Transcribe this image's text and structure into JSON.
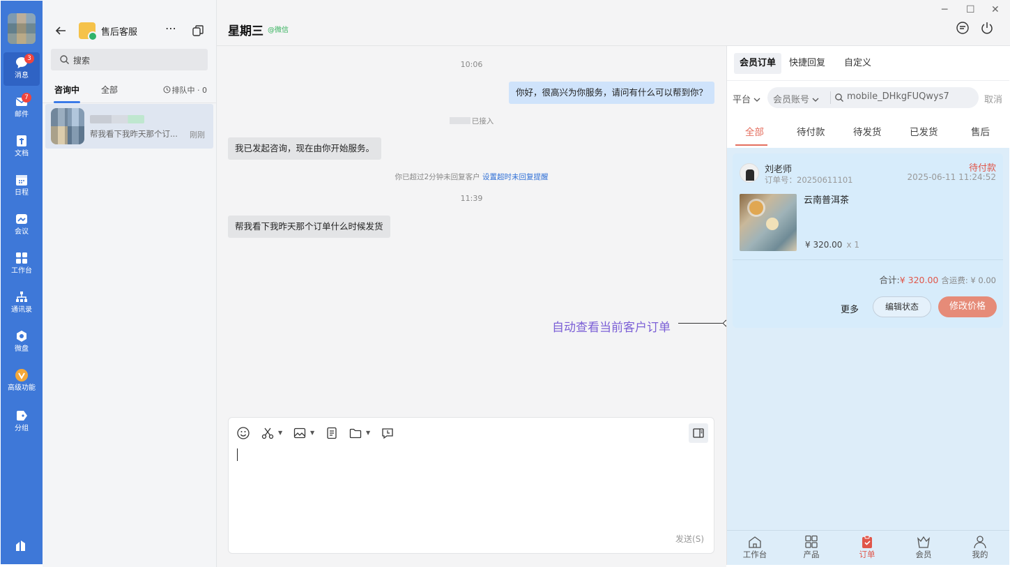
{
  "rail": {
    "items": [
      {
        "label": "消息",
        "badge": "3",
        "icon": "chat-bubble-icon"
      },
      {
        "label": "邮件",
        "badge": "7",
        "icon": "mail-icon"
      },
      {
        "label": "文档",
        "icon": "document-icon"
      },
      {
        "label": "日程",
        "icon": "calendar-icon"
      },
      {
        "label": "会议",
        "icon": "meeting-icon"
      },
      {
        "label": "工作台",
        "icon": "grid-icon"
      },
      {
        "label": "通讯录",
        "icon": "org-chart-icon"
      },
      {
        "label": "微盘",
        "icon": "cloud-drive-icon"
      },
      {
        "label": "高级功能",
        "icon": "premium-icon"
      },
      {
        "label": "分组",
        "icon": "tag-icon"
      }
    ]
  },
  "list": {
    "shop_name": "售后客服",
    "search_placeholder": "搜索",
    "tab_active": "咨询中",
    "tab_all": "全部",
    "queue": "排队中 · 0",
    "conversation": {
      "preview": "帮我看下我昨天那个订...",
      "time": "刚刚"
    }
  },
  "chat": {
    "title": "星期三",
    "channel": "@微信",
    "messages": {
      "time1": "10:06",
      "greeting": "你好，很高兴为你服务，请问有什么可以帮到你？",
      "joined": "已接入",
      "started": "我已发起咨询，现在由你开始服务。",
      "timeout_note": "你已超过2分钟未回复客户",
      "timeout_link": "设置超时未回复提醒",
      "time2": "11:39",
      "customer_msg": "帮我看下我昨天那个订单什么时候发货"
    },
    "annotation": "自动查看当前客户订单",
    "send_label": "发送(S)"
  },
  "window_controls": {
    "minimize": "─",
    "maximize": "☐",
    "close": "✕"
  },
  "right": {
    "tabs": [
      "会员订单",
      "快捷回复",
      "自定义"
    ],
    "platform": "平台",
    "account_label": "会员账号",
    "account_value": "mobile_DHkgFUQwys7",
    "cancel": "取消",
    "status_tabs": [
      "全部",
      "待付款",
      "待发货",
      "已发货",
      "售后"
    ],
    "order": {
      "customer": "刘老师",
      "order_no": "订单号：20250611101",
      "status": "待付款",
      "time": "2025-06-11 11:24:52",
      "product": "云南普洱茶",
      "price": "¥ 320.00",
      "qty": "x 1",
      "total_label": "合计:",
      "total_amount": "¥ 320.00",
      "shipping": "含运费: ¥ 0.00",
      "btn_more": "更多",
      "btn_edit": "编辑状态",
      "btn_price": "修改价格"
    },
    "bottom_nav": [
      "工作台",
      "产品",
      "订单",
      "会员",
      "我的"
    ],
    "colors": {
      "accent": "#e46e5e",
      "rail": "#3e78d8",
      "panel": "#ddedf9"
    }
  }
}
